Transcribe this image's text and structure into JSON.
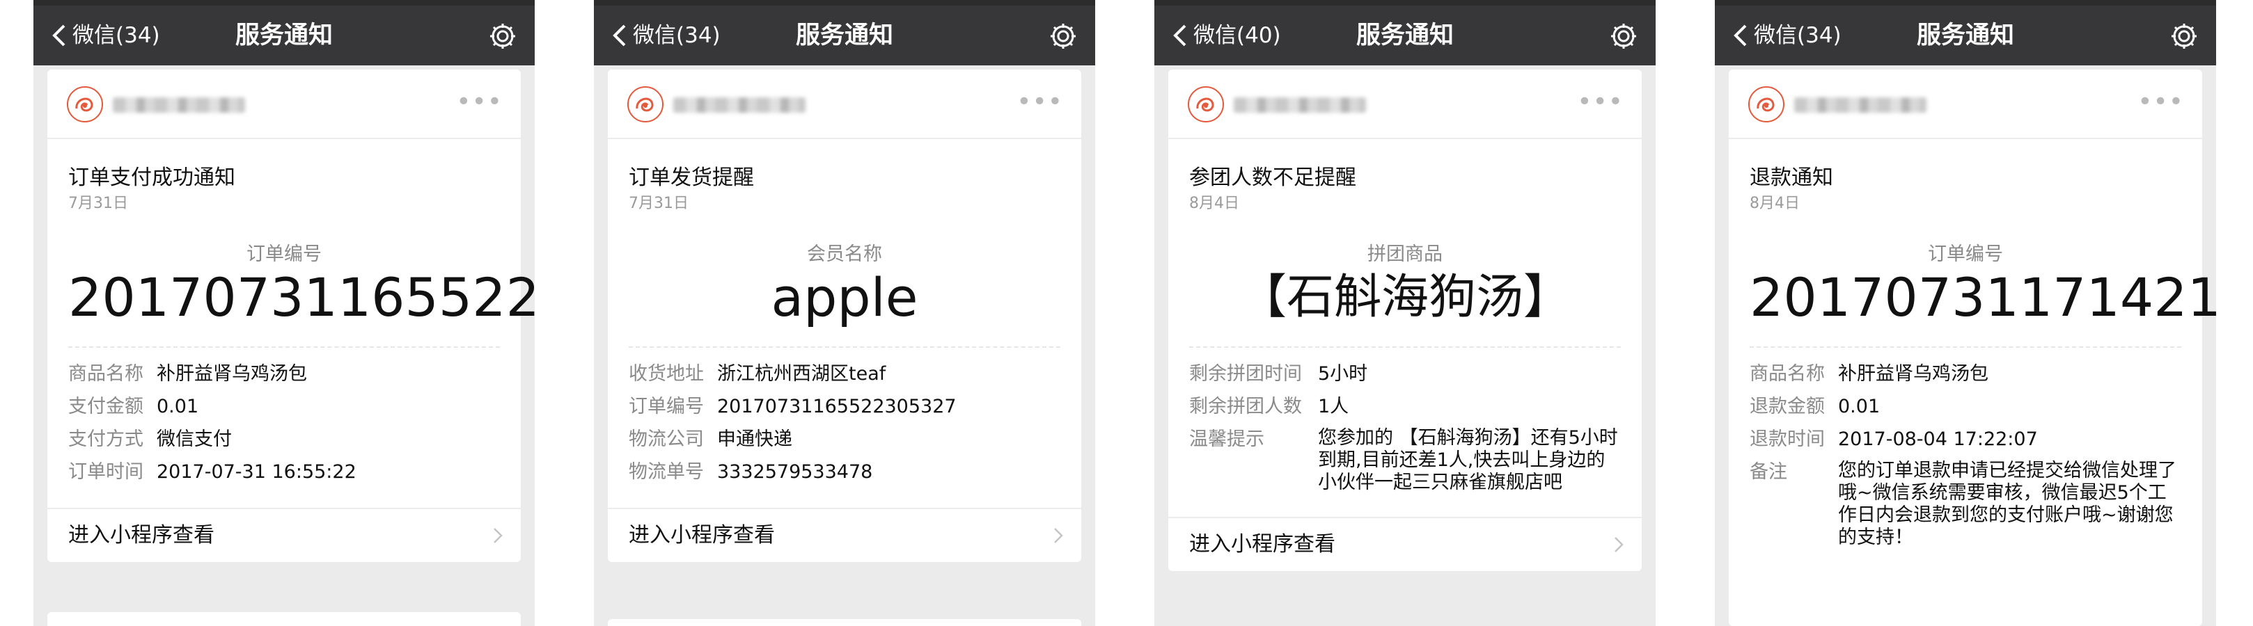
{
  "colors": {
    "navbar": "#37373a",
    "background": "#ebebeb",
    "avatar_accent": "#e35a3c"
  },
  "icons": {
    "back": "chevron-left-icon",
    "settings": "gear-icon",
    "more": "more-dots-icon",
    "enter": "chevron-right-icon"
  },
  "screens": [
    {
      "nav": {
        "back_label": "微信(34)",
        "title": "服务通知"
      },
      "card": {
        "title": "订单支付成功通知",
        "date": "7月31日",
        "key_label": "订单编号",
        "key_value": "20170731165522",
        "fields": [
          {
            "label": "商品名称",
            "value": "补肝益肾乌鸡汤包"
          },
          {
            "label": "支付金额",
            "value": "0.01"
          },
          {
            "label": "支付方式",
            "value": "微信支付"
          },
          {
            "label": "订单时间",
            "value": "2017-07-31 16:55:22"
          }
        ],
        "footer": "进入小程序查看"
      }
    },
    {
      "nav": {
        "back_label": "微信(34)",
        "title": "服务通知"
      },
      "card": {
        "title": "订单发货提醒",
        "date": "7月31日",
        "key_label": "会员名称",
        "key_value": "apple",
        "fields": [
          {
            "label": "收货地址",
            "value": "浙江杭州西湖区teaf"
          },
          {
            "label": "订单编号",
            "value": "20170731165522305327"
          },
          {
            "label": "物流公司",
            "value": "申通快递"
          },
          {
            "label": "物流单号",
            "value": "3332579533478"
          }
        ],
        "footer": "进入小程序查看"
      }
    },
    {
      "nav": {
        "back_label": "微信(40)",
        "title": "服务通知"
      },
      "card": {
        "title": "参团人数不足提醒",
        "date": "8月4日",
        "key_label": "拼团商品",
        "key_value": "【石斛海狗汤】",
        "fields": [
          {
            "label": "剩余拼团时间",
            "value": "5小时"
          },
          {
            "label": "剩余拼团人数",
            "value": "1人"
          },
          {
            "label": "温馨提示",
            "value": "您参加的 【石斛海狗汤】还有5小时到期,目前还差1人,快去叫上身边的小伙伴一起三只麻雀旗舰店吧"
          }
        ],
        "footer": "进入小程序查看"
      }
    },
    {
      "nav": {
        "back_label": "微信(34)",
        "title": "服务通知"
      },
      "card": {
        "title": "退款通知",
        "date": "8月4日",
        "key_label": "订单编号",
        "key_value": "20170731171421",
        "fields": [
          {
            "label": "商品名称",
            "value": "补肝益肾乌鸡汤包"
          },
          {
            "label": "退款金额",
            "value": "0.01"
          },
          {
            "label": "退款时间",
            "value": "2017-08-04 17:22:07"
          },
          {
            "label": "备注",
            "value": "您的订单退款申请已经提交给微信处理了哦~微信系统需要审核，微信最迟5个工作日内会退款到您的支付账户哦~谢谢您的支持！"
          }
        ],
        "footer": ""
      }
    }
  ]
}
